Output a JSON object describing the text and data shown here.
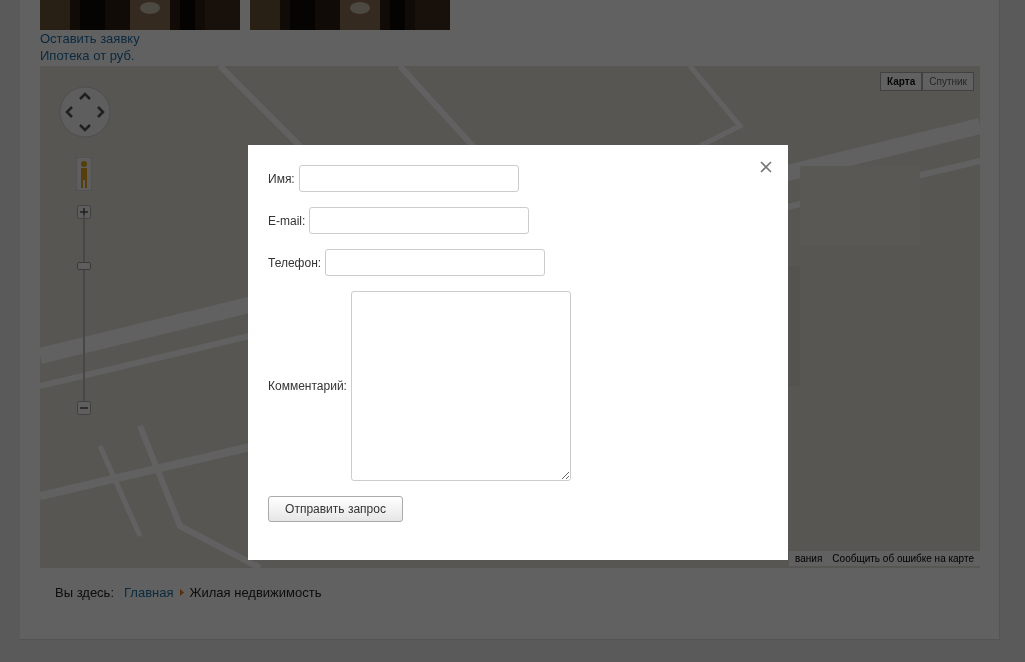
{
  "links": [
    "Оставить заявку",
    "Ипотека от руб."
  ],
  "map": {
    "map_types": [
      {
        "label": "Карта",
        "selected": true
      },
      {
        "label": "Спутник",
        "selected": false
      }
    ],
    "zoom": {
      "level": 0.73
    },
    "footer_links": [
      "вания",
      "Сообщить об ошибке на карте"
    ]
  },
  "breadcrumb": {
    "prefix": "Вы здесь:",
    "items": [
      "Главная",
      "Жилая недвижимость"
    ]
  },
  "dialog": {
    "fields": [
      {
        "label": "Имя:",
        "kind": "input"
      },
      {
        "label": "E-mail:",
        "kind": "input"
      },
      {
        "label": "Телефон:",
        "kind": "input"
      },
      {
        "label": "Комментарий:",
        "kind": "textarea"
      }
    ],
    "submit": "Отправить запрос"
  }
}
